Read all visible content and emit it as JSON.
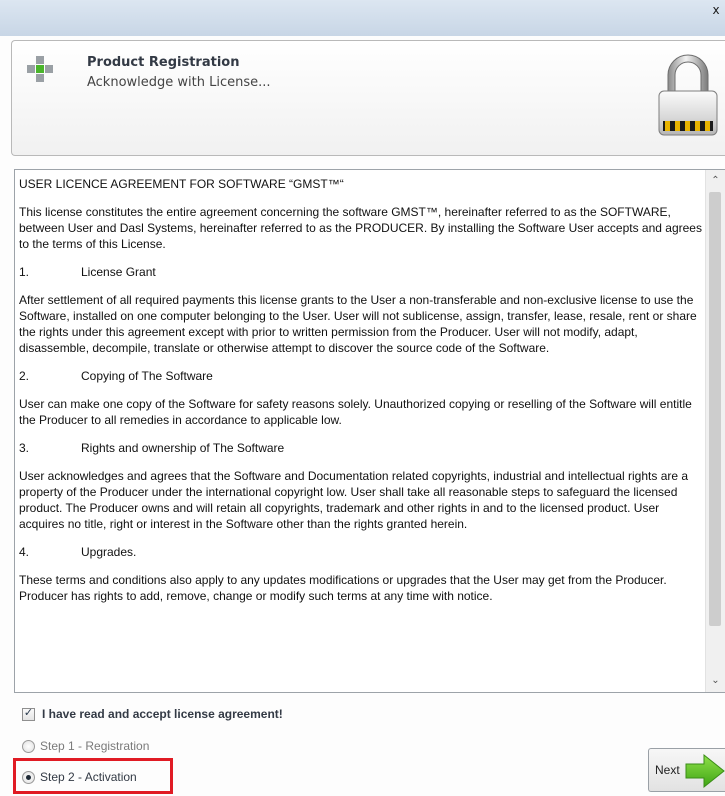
{
  "window": {
    "close_glyph": "x"
  },
  "header": {
    "title": "Product Registration",
    "subtitle": "Acknowledge with License...",
    "icon": "green-cross-icon",
    "lock_icon": "padlock-icon"
  },
  "license": {
    "heading": "USER LICENCE AGREEMENT FOR SOFTWARE “GMST™“",
    "intro": "This license constitutes the entire agreement concerning the software GMST™, hereinafter referred to as the SOFTWARE, between User and Dasl Systems, hereinafter referred to as the PRODUCER. By installing the Software User accepts and agrees to the terms of this License.",
    "sections": [
      {
        "number": "1.",
        "title": "License Grant",
        "body": "After settlement of all required payments this license grants to the User a non-transferable and non-exclusive license to use the Software, installed on one computer belonging to the User. User will not sublicense, assign, transfer, lease, resale, rent or share the rights under this agreement except with prior to written permission from the Producer. User will not modify, adapt, disassemble, decompile, translate or otherwise attempt to discover the source code of the Software."
      },
      {
        "number": "2.",
        "title": "Copying of The Software",
        "body": "User can make one copy of the Software for safety reasons solely. Unauthorized copying or reselling of the Software will entitle the Producer to all remedies in accordance to applicable low."
      },
      {
        "number": "3.",
        "title": "Rights and ownership of The Software",
        "body": "User acknowledges and agrees that the Software and Documentation related copyrights, industrial and intellectual rights are a property of the Producer under the international copyright low. User shall take all reasonable steps to safeguard the licensed product. The Producer owns and will retain all copyrights, trademark and other rights in and to the licensed product.  User acquires no title, right or interest in the Software other than the rights granted herein."
      },
      {
        "number": "4.",
        "title": "Upgrades.",
        "body": "These terms and conditions also apply to any updates modifications or upgrades that the User may get from the Producer. Producer has rights to add, remove, change or modify such terms at any time with notice."
      }
    ]
  },
  "accept": {
    "label": "I have read and accept license agreement!",
    "checked": true
  },
  "steps": [
    {
      "label": "Step 1 - Registration",
      "selected": false
    },
    {
      "label": "Step 2 - Activation",
      "selected": true
    }
  ],
  "next_button": {
    "label": "Next",
    "icon": "green-arrow-right-icon"
  },
  "colors": {
    "highlight": "#e01b24",
    "arrow": "#5cc21f"
  }
}
